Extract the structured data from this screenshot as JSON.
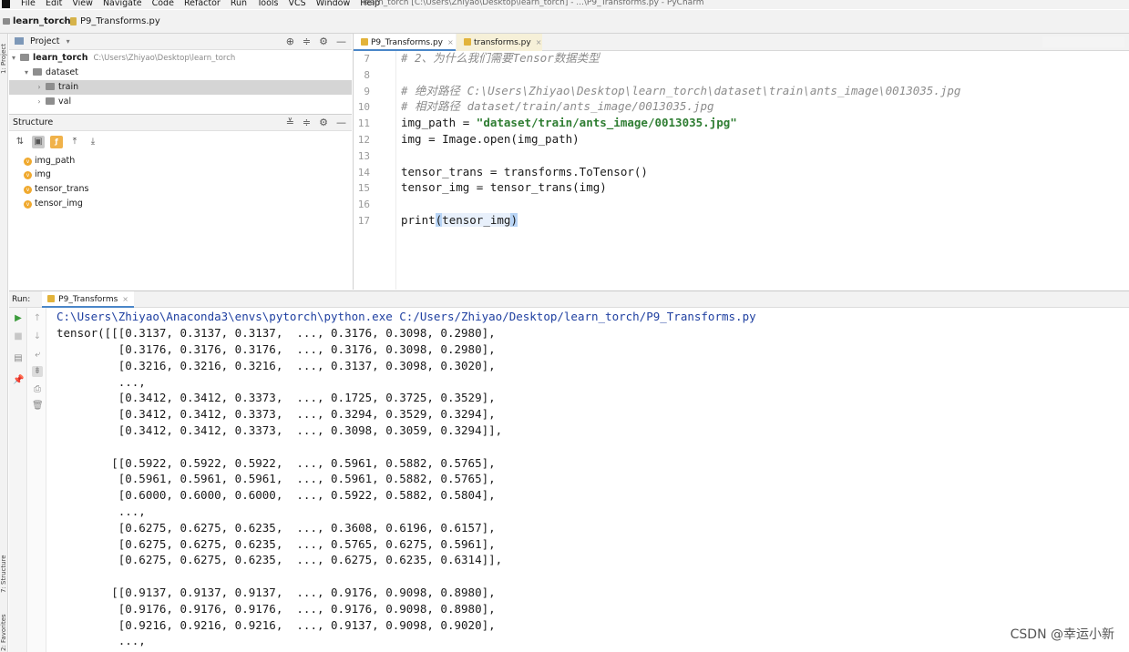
{
  "menubar": {
    "items": [
      "File",
      "Edit",
      "View",
      "Navigate",
      "Code",
      "Refactor",
      "Run",
      "Tools",
      "VCS",
      "Window",
      "Help"
    ],
    "window_title": "learn_torch [C:\\Users\\Zhiyao\\Desktop\\learn_torch] - ...\\P9_Transforms.py - PyCharm"
  },
  "navbar": {
    "project": "learn_torch",
    "file": "P9_Transforms.py"
  },
  "toolstrip": {
    "project_label": "1: Project",
    "structure_label": "7: Structure",
    "favorites_label": "2: Favorites"
  },
  "project_panel": {
    "title": "Project",
    "root": {
      "name": "learn_torch",
      "path": "C:\\Users\\Zhiyao\\Desktop\\learn_torch"
    },
    "items": [
      {
        "name": "dataset"
      },
      {
        "name": "train"
      },
      {
        "name": "val"
      }
    ]
  },
  "structure_panel": {
    "title": "Structure",
    "items": [
      "img_path",
      "img",
      "tensor_trans",
      "tensor_img"
    ]
  },
  "editor": {
    "tabs": [
      {
        "label": "P9_Transforms.py",
        "active": true
      },
      {
        "label": "transforms.py",
        "active": false
      }
    ],
    "line_numbers": [
      "7",
      "8",
      "9",
      "10",
      "11",
      "12",
      "13",
      "14",
      "15",
      "16",
      "17"
    ],
    "lines": {
      "l7": "# 2、为什么我们需要Tensor数据类型",
      "l8": "",
      "l9": "# 绝对路径 C:\\Users\\Zhiyao\\Desktop\\learn_torch\\dataset\\train\\ants_image\\0013035.jpg",
      "l10": "# 相对路径 dataset/train/ants_image/0013035.jpg",
      "l11_a": "img_path = ",
      "l11_b": "\"dataset/train/ants_image/0013035.jpg\"",
      "l12": "img = Image.open(img_path)",
      "l13": "",
      "l14": "tensor_trans = transforms.ToTensor()",
      "l15": "tensor_img = tensor_trans(img)",
      "l16": "",
      "l17_a": "print",
      "l17_b": "(",
      "l17_c": "tensor_img",
      "l17_d": ")"
    }
  },
  "run_panel": {
    "label": "Run:",
    "config": "P9_Transforms",
    "output": [
      "C:\\Users\\Zhiyao\\Anaconda3\\envs\\pytorch\\python.exe C:/Users/Zhiyao/Desktop/learn_torch/P9_Transforms.py",
      "tensor([[[0.3137, 0.3137, 0.3137,  ..., 0.3176, 0.3098, 0.2980],",
      "         [0.3176, 0.3176, 0.3176,  ..., 0.3176, 0.3098, 0.2980],",
      "         [0.3216, 0.3216, 0.3216,  ..., 0.3137, 0.3098, 0.3020],",
      "         ...,",
      "         [0.3412, 0.3412, 0.3373,  ..., 0.1725, 0.3725, 0.3529],",
      "         [0.3412, 0.3412, 0.3373,  ..., 0.3294, 0.3529, 0.3294],",
      "         [0.3412, 0.3412, 0.3373,  ..., 0.3098, 0.3059, 0.3294]],",
      "",
      "        [[0.5922, 0.5922, 0.5922,  ..., 0.5961, 0.5882, 0.5765],",
      "         [0.5961, 0.5961, 0.5961,  ..., 0.5961, 0.5882, 0.5765],",
      "         [0.6000, 0.6000, 0.6000,  ..., 0.5922, 0.5882, 0.5804],",
      "         ...,",
      "         [0.6275, 0.6275, 0.6235,  ..., 0.3608, 0.6196, 0.6157],",
      "         [0.6275, 0.6275, 0.6235,  ..., 0.5765, 0.6275, 0.5961],",
      "         [0.6275, 0.6275, 0.6235,  ..., 0.6275, 0.6235, 0.6314]],",
      "",
      "        [[0.9137, 0.9137, 0.9137,  ..., 0.9176, 0.9098, 0.8980],",
      "         [0.9176, 0.9176, 0.9176,  ..., 0.9176, 0.9098, 0.8980],",
      "         [0.9216, 0.9216, 0.9216,  ..., 0.9137, 0.9098, 0.9020],",
      "         ...,"
    ]
  },
  "watermark": "CSDN @幸运小新",
  "colors": {
    "accent": "#4a86c8",
    "comment": "#8c8c8c",
    "string": "#2e7d32",
    "path_output": "#1e3fa0"
  }
}
